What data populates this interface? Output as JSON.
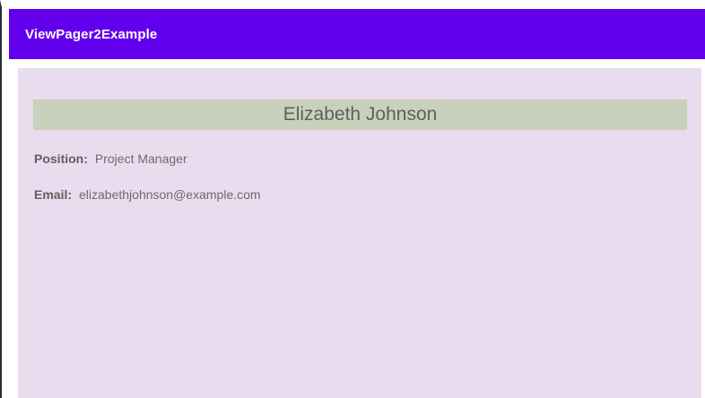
{
  "app_bar": {
    "title": "ViewPager2Example"
  },
  "profile": {
    "name": "Elizabeth Johnson",
    "fields": [
      {
        "label": "Position:",
        "value": "Project Manager"
      },
      {
        "label": "Email:",
        "value": "elizabethjohnson@example.com"
      }
    ]
  },
  "colors": {
    "app_bar": "#6200ee",
    "card_background": "#eadcef",
    "name_banner": "#c7d1bb"
  }
}
